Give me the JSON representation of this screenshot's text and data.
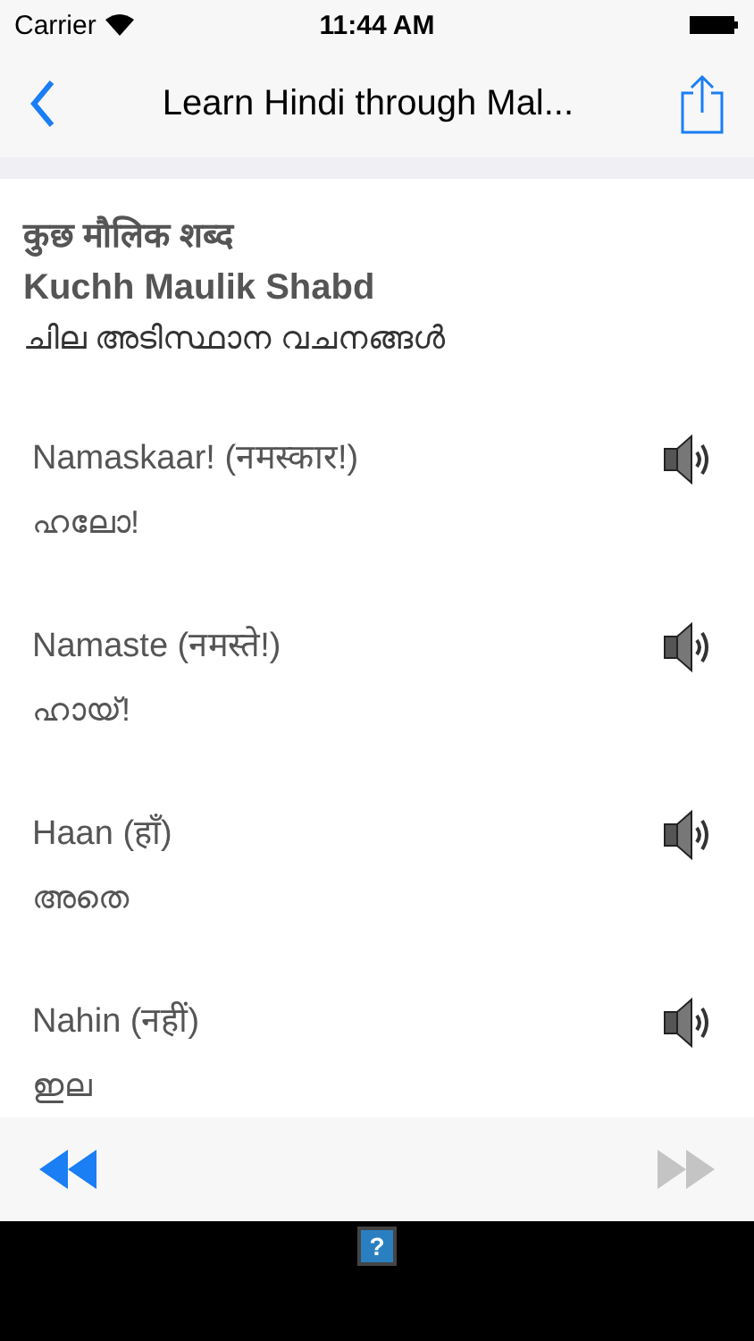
{
  "status_bar": {
    "carrier": "Carrier",
    "time": "11:44 AM"
  },
  "nav_bar": {
    "title": "Learn Hindi through Mal..."
  },
  "header": {
    "hindi": "कुछ मौलिक शब्द",
    "transliteration": "Kuchh Maulik Shabd",
    "malayalam": "ചില അടിസ്ഥാന വചനങ്ങൾ"
  },
  "phrases": [
    {
      "phrase": "Namaskaar! (नमस्कार!)",
      "translation": "ഹലോ!"
    },
    {
      "phrase": "Namaste (नमस्ते!)",
      "translation": "ഹായ്!"
    },
    {
      "phrase": "Haan (हाँ)",
      "translation": "അതെ"
    },
    {
      "phrase": "Nahin (नहीं)",
      "translation": "ഇല"
    }
  ],
  "toolbar": {
    "previous_disabled": false,
    "next_disabled": true
  },
  "ad_area": {
    "placeholder_glyph": "?"
  }
}
